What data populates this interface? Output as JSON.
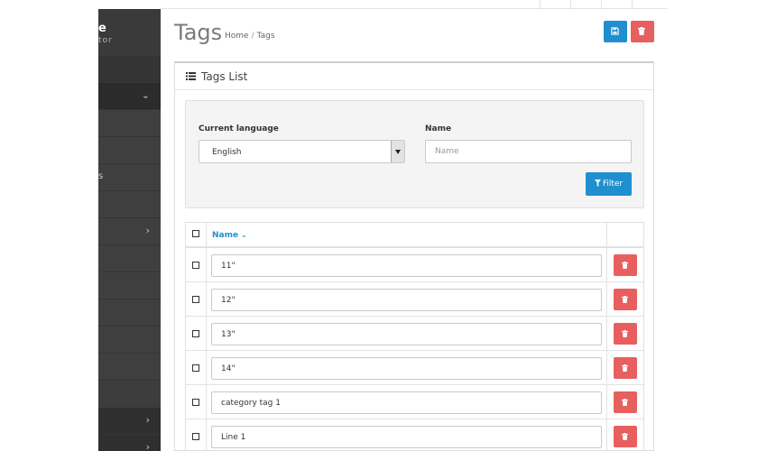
{
  "sidebar": {
    "brand_title": "e",
    "brand_subtitle": "tor",
    "items": [
      {
        "label": ""
      },
      {
        "label": "",
        "chevron": "⌄"
      },
      {
        "label": ""
      },
      {
        "label": ""
      },
      {
        "label": "s"
      },
      {
        "label": ""
      },
      {
        "label": "",
        "chevron": "›"
      },
      {
        "label": ""
      },
      {
        "label": ""
      },
      {
        "label": ""
      },
      {
        "label": ""
      },
      {
        "label": ""
      },
      {
        "label": "",
        "chevron": "›"
      },
      {
        "label": "",
        "chevron": "›"
      }
    ]
  },
  "header": {
    "title": "Tags",
    "breadcrumb": [
      "Home",
      "Tags"
    ]
  },
  "toolbar": {
    "save_icon": "floppy-disk-icon",
    "delete_icon": "trash-icon"
  },
  "panel": {
    "title": "Tags List",
    "icon": "list-icon"
  },
  "filter": {
    "language_label": "Current language",
    "language_value": "English",
    "name_label": "Name",
    "name_placeholder": "Name",
    "name_value": "",
    "button_label": "Filter",
    "button_icon": "funnel-icon"
  },
  "table": {
    "column_name": "Name",
    "sort_icon": "chevron-down-icon",
    "rows": [
      {
        "value": "11\""
      },
      {
        "value": "12\""
      },
      {
        "value": "13\""
      },
      {
        "value": "14\""
      },
      {
        "value": "category tag 1"
      },
      {
        "value": "Line 1"
      }
    ]
  },
  "colors": {
    "primary": "#1f8fd0",
    "danger": "#e85f5f",
    "sidebar": "#3d3d3d"
  }
}
